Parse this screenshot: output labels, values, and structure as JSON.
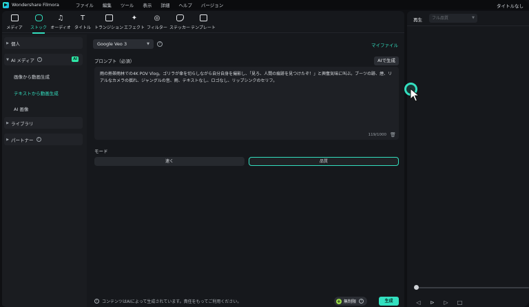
{
  "menubar": {
    "app_name": "Wondershare Filmora",
    "items": [
      "ファイル",
      "編集",
      "ツール",
      "表示",
      "詳細",
      "ヘルプ",
      "バージョン"
    ],
    "right_title": "タイトルなし"
  },
  "toolbar": {
    "tools": [
      {
        "label": "メディア",
        "icon": "media-icon"
      },
      {
        "label": "ストック",
        "icon": "stock-icon",
        "active": true
      },
      {
        "label": "オーディオ",
        "icon": "audio-icon"
      },
      {
        "label": "タイトル",
        "icon": "title-icon"
      },
      {
        "label": "トランジション",
        "icon": "transition-icon"
      },
      {
        "label": "エフェクト",
        "icon": "effect-icon"
      },
      {
        "label": "フィルター",
        "icon": "filter-icon"
      },
      {
        "label": "ステッカー",
        "icon": "sticker-icon"
      },
      {
        "label": "テンプレート",
        "icon": "template-icon"
      }
    ]
  },
  "sidebar": {
    "personal": "個人",
    "ai_media": "AI メディア",
    "ai_badge": "AI",
    "sub_items": [
      "画像から動画生成",
      "テキストから動画生成",
      "AI 画像"
    ],
    "library": "ライブラリ",
    "partner": "パートナー"
  },
  "content": {
    "model": "Google Veo 3",
    "my_file": "マイファイル",
    "prompt_label": "プロンプト（必須）",
    "ai_generate": "AIで生成",
    "prompt_text": "雨の熱帯雨林での4K POV Vlog。ゴリラが傘を切らしながら自分自身を撮影し、「見ろ、人間の痕跡を見つけたぞ！」と興奮気味に叫ぶ。ブーツの跡、煙、リアルなカメラの揺れ、ジャングルの音、雨、テキストなし、ロゴなし、リップシンクのセリフ。",
    "counter": "119/1000",
    "mode_label": "モード",
    "mode_fast": "速く",
    "mode_quality": "品質",
    "footer_note": "コンテンツはAIによって生成されています。責任をもってご利用ください。",
    "unlimited": "無制限",
    "generate": "生成"
  },
  "preview": {
    "label": "再生",
    "quality_placeholder": "フル品質"
  },
  "colors": {
    "accent": "#33e0c0",
    "panel": "#16181c",
    "background": "#0f1013"
  }
}
